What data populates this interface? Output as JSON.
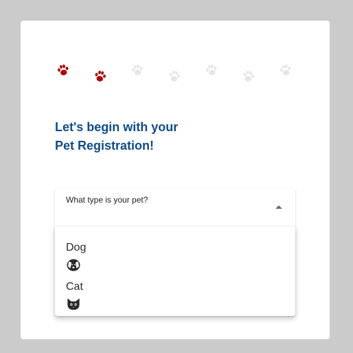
{
  "progress": {
    "total_steps": 7,
    "completed_steps": 2,
    "active_color": "#b00000",
    "inactive_color": "#e6e6e6"
  },
  "heading": {
    "line1": "Let's begin with your",
    "line2": "Pet Registration!"
  },
  "pet_type_select": {
    "label": "What type is your pet?",
    "value": "",
    "expanded": true,
    "options": [
      {
        "label": "Dog",
        "icon": "dog-icon"
      },
      {
        "label": "Cat",
        "icon": "cat-icon"
      }
    ]
  }
}
